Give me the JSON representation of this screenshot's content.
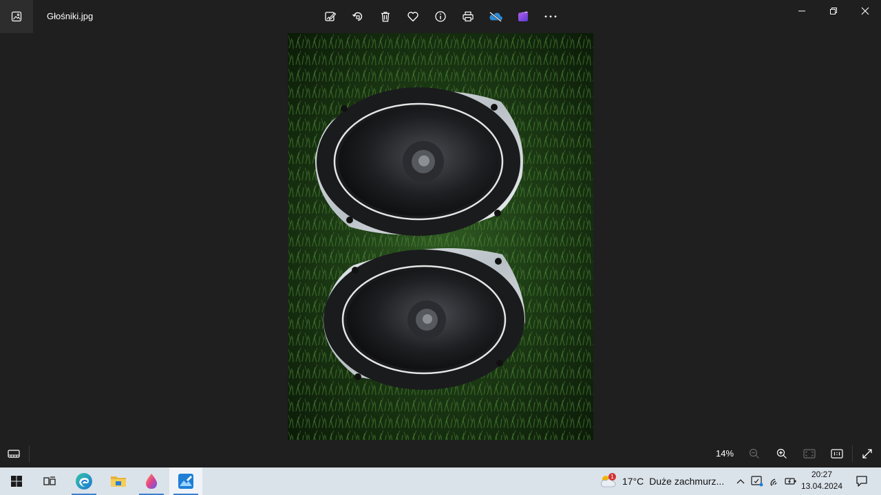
{
  "window": {
    "filename": "Głośniki.jpg"
  },
  "toolbar": {
    "items": [
      "edit-image-icon",
      "rotate-icon",
      "delete-icon",
      "favorite-icon",
      "info-icon",
      "print-icon",
      "onedrive-icon",
      "clipchamp-icon",
      "more-icon"
    ]
  },
  "bottombar": {
    "zoom": "14%"
  },
  "taskbar": {
    "weather_temp": "17°C",
    "weather_desc": "Duże zachmurz...",
    "weather_badge": "1",
    "time": "20:27",
    "date": "13.04.2024"
  },
  "colors": {
    "background": "#1f1f1f",
    "taskbar": "#dbe3ea",
    "accent": "#3b7ed1"
  }
}
